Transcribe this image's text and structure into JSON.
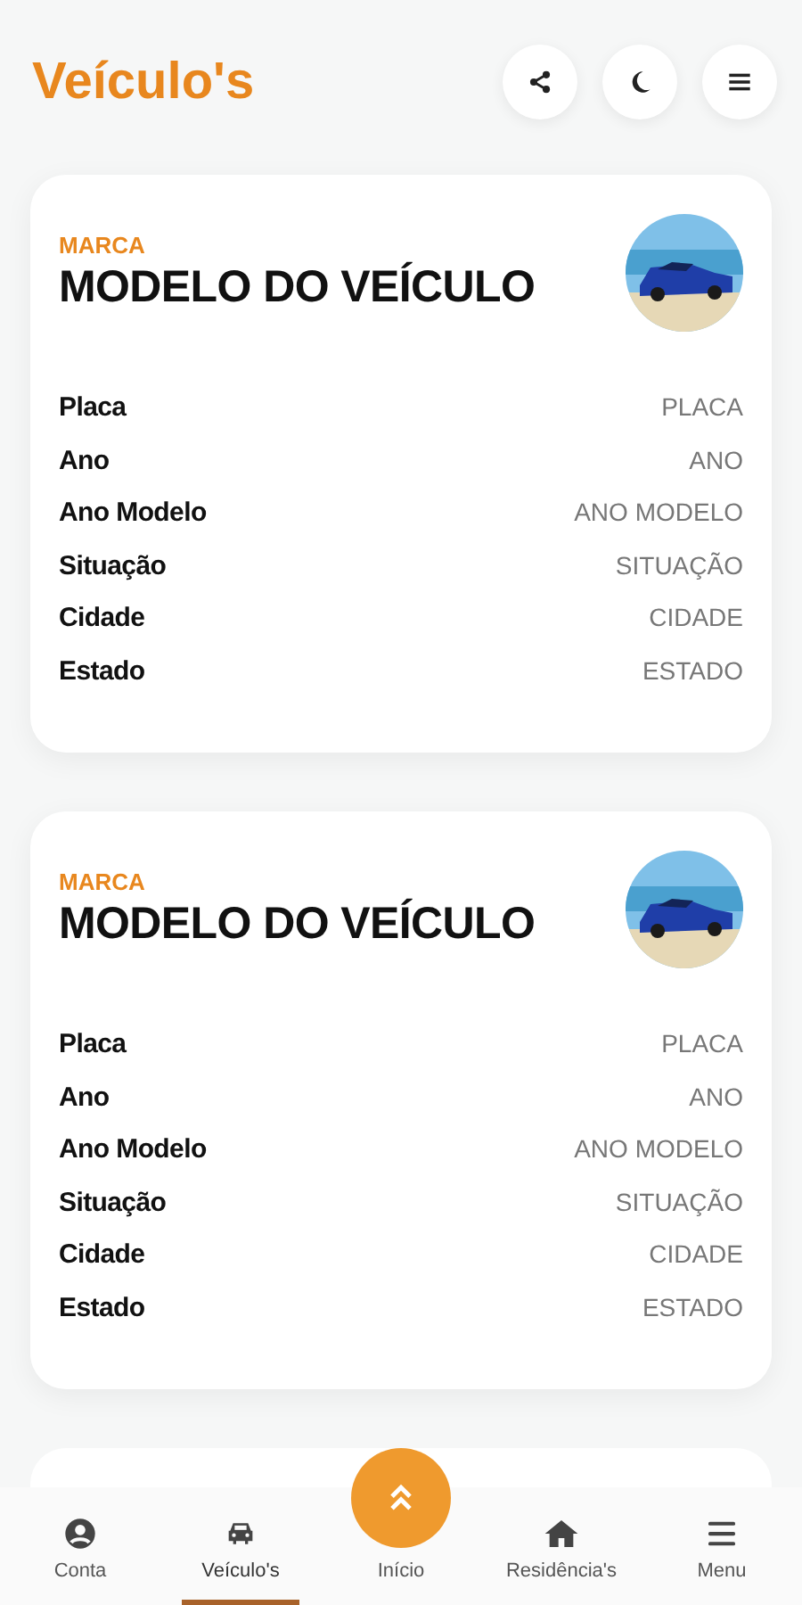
{
  "header": {
    "title": "Veículo's"
  },
  "vehicles": [
    {
      "brand": "MARCA",
      "model": "MODELO DO VEÍCULO",
      "fields": [
        {
          "label": "Placa",
          "value": "PLACA"
        },
        {
          "label": "Ano",
          "value": "ANO"
        },
        {
          "label": "Ano Modelo",
          "value": "ANO MODELO"
        },
        {
          "label": "Situação",
          "value": "SITUAÇÃO"
        },
        {
          "label": "Cidade",
          "value": "CIDADE"
        },
        {
          "label": "Estado",
          "value": "ESTADO"
        }
      ]
    },
    {
      "brand": "MARCA",
      "model": "MODELO DO VEÍCULO",
      "fields": [
        {
          "label": "Placa",
          "value": "PLACA"
        },
        {
          "label": "Ano",
          "value": "ANO"
        },
        {
          "label": "Ano Modelo",
          "value": "ANO MODELO"
        },
        {
          "label": "Situação",
          "value": "SITUAÇÃO"
        },
        {
          "label": "Cidade",
          "value": "CIDADE"
        },
        {
          "label": "Estado",
          "value": "ESTADO"
        }
      ]
    }
  ],
  "bottom_nav": [
    {
      "kind": "account",
      "label": "Conta",
      "selected": false
    },
    {
      "kind": "car",
      "label": "Veículo's",
      "selected": true
    },
    {
      "kind": "home-fab",
      "label": "Início",
      "selected": false
    },
    {
      "kind": "house",
      "label": "Residência's",
      "selected": false
    },
    {
      "kind": "menu",
      "label": "Menu",
      "selected": false
    }
  ]
}
